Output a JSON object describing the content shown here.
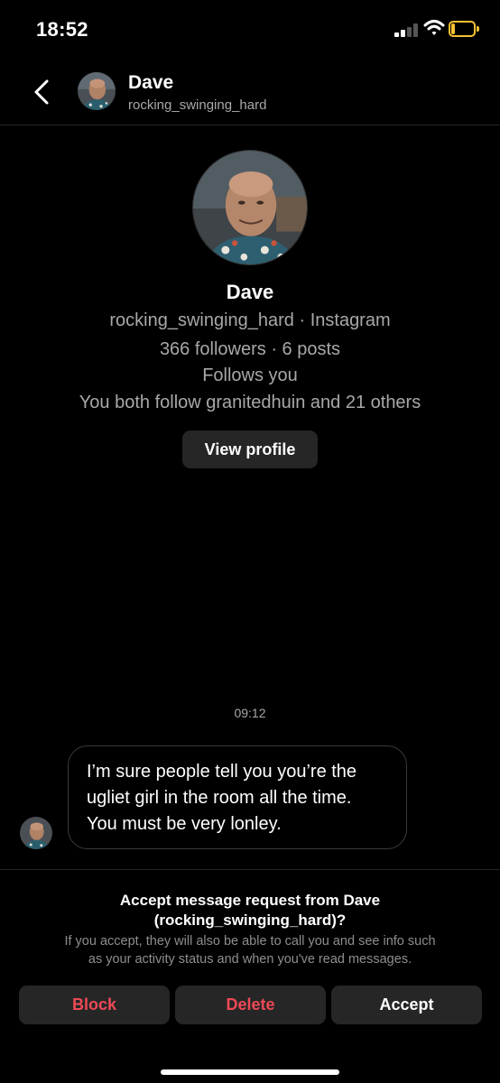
{
  "status_bar": {
    "time": "18:52",
    "battery_level": 0.18,
    "battery_color": "#f6c231",
    "icons": [
      "signal-icon",
      "wifi-icon",
      "battery-icon"
    ]
  },
  "header": {
    "name": "Dave",
    "username": "rocking_swinging_hard",
    "back_icon": "chevron-left-icon"
  },
  "profile": {
    "name": "Dave",
    "handle_line": "rocking_swinging_hard · Instagram",
    "stats_line": "366 followers · 6 posts",
    "follows_line": "Follows you",
    "mutual_line": "You both follow granitedhuin and 21 others",
    "view_profile_label": "View profile"
  },
  "chat": {
    "timestamp": "09:12",
    "messages": [
      {
        "sender": "Dave",
        "lines": [
          "I’m sure people tell you you’re the",
          "ugliet girl in the room all the time.",
          "You must be very lonley."
        ]
      }
    ]
  },
  "request": {
    "title_line1": "Accept message request from Dave",
    "title_line2": "(rocking_swinging_hard)?",
    "desc_line1": "If you accept, they will also be able to call you and see info such",
    "desc_line2": "as your activity status and when you've read messages.",
    "block_label": "Block",
    "delete_label": "Delete",
    "accept_label": "Accept"
  },
  "colors": {
    "background": "#000000",
    "button_bg": "#262626",
    "danger": "#ed4956",
    "secondary_text": "#a8a8a8"
  }
}
